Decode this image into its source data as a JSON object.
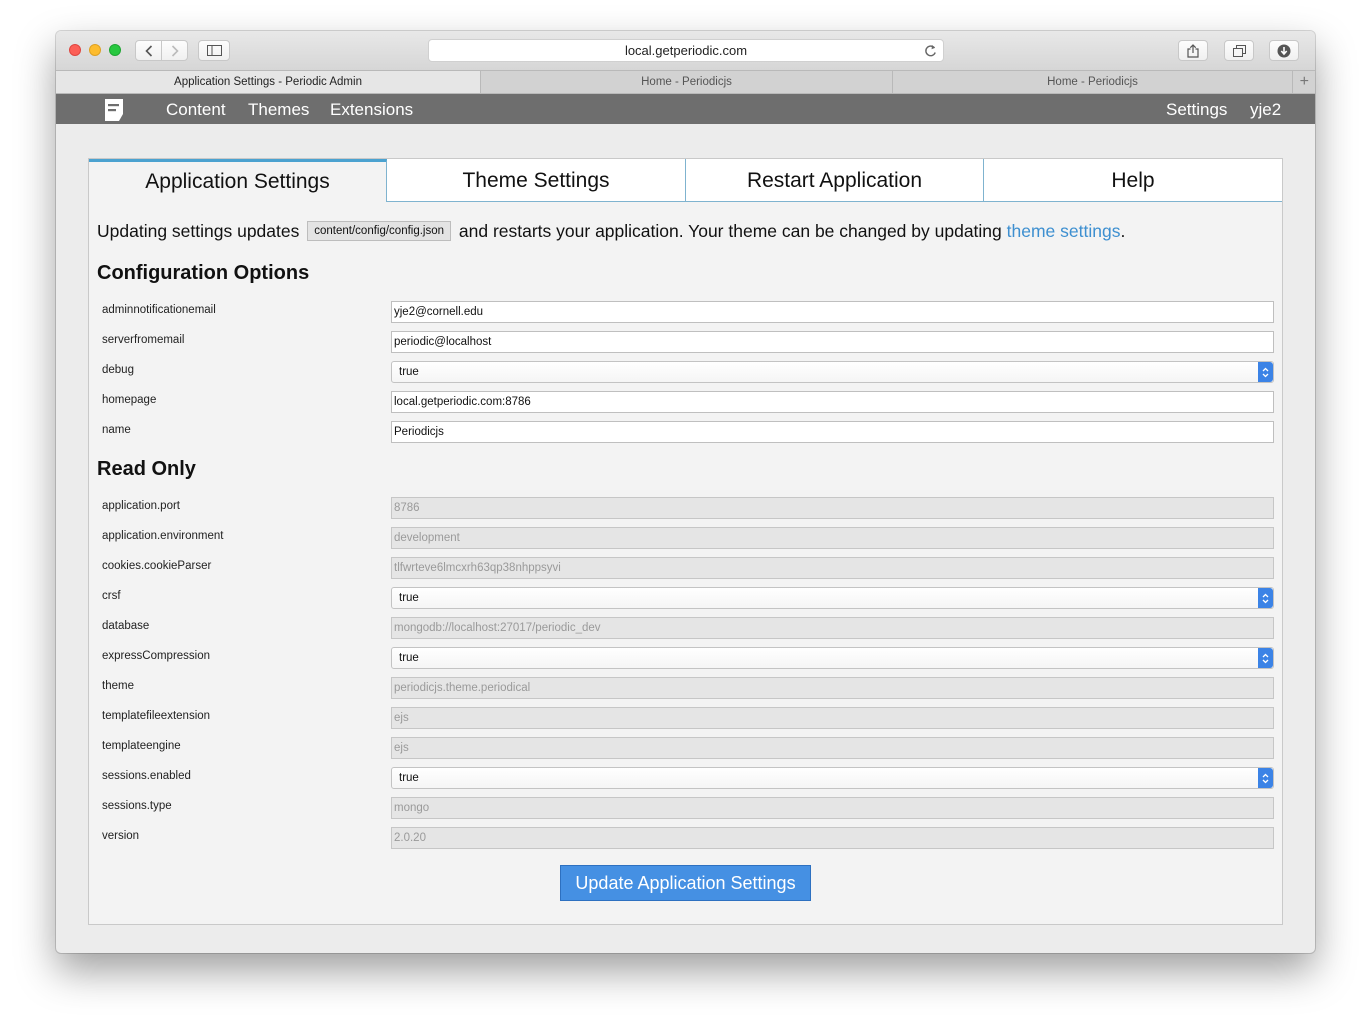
{
  "browser": {
    "url": "local.getperiodic.com",
    "tabs": [
      {
        "label": "Application Settings - Periodic Admin",
        "active": true
      },
      {
        "label": "Home - Periodicjs",
        "active": false
      },
      {
        "label": "Home - Periodicjs",
        "active": false
      }
    ],
    "new_tab": "+"
  },
  "nav": {
    "items": [
      "Content",
      "Themes",
      "Extensions"
    ],
    "settings": "Settings",
    "user": "yje2"
  },
  "tabs": [
    "Application Settings",
    "Theme Settings",
    "Restart Application",
    "Help"
  ],
  "intro": {
    "before": "Updating settings updates",
    "code": "content/config/config.json",
    "middle": " and restarts your application. Your theme can be changed by updating ",
    "link": "theme settings",
    "after": "."
  },
  "config": {
    "heading": "Configuration Options",
    "fields": [
      {
        "label": "adminnotificationemail",
        "value": "yje2@cornell.edu",
        "type": "text"
      },
      {
        "label": "serverfromemail",
        "value": "periodic@localhost",
        "type": "text"
      },
      {
        "label": "debug",
        "value": "true",
        "type": "select"
      },
      {
        "label": "homepage",
        "value": "local.getperiodic.com:8786",
        "type": "text"
      },
      {
        "label": "name",
        "value": "Periodicjs",
        "type": "text"
      }
    ]
  },
  "readonly": {
    "heading": "Read Only",
    "fields": [
      {
        "label": "application.port",
        "value": "8786",
        "type": "readonly"
      },
      {
        "label": "application.environment",
        "value": "development",
        "type": "readonly"
      },
      {
        "label": "cookies.cookieParser",
        "value": "tlfwrteve6lmcxrh63qp38nhppsyvi",
        "type": "readonly"
      },
      {
        "label": "crsf",
        "value": "true",
        "type": "select"
      },
      {
        "label": "database",
        "value": "mongodb://localhost:27017/periodic_dev",
        "type": "readonly"
      },
      {
        "label": "expressCompression",
        "value": "true",
        "type": "select"
      },
      {
        "label": "theme",
        "value": "periodicjs.theme.periodical",
        "type": "readonly"
      },
      {
        "label": "templatefileextension",
        "value": "ejs",
        "type": "readonly"
      },
      {
        "label": "templateengine",
        "value": "ejs",
        "type": "readonly"
      },
      {
        "label": "sessions.enabled",
        "value": "true",
        "type": "select"
      },
      {
        "label": "sessions.type",
        "value": "mongo",
        "type": "readonly"
      },
      {
        "label": "version",
        "value": "2.0.20",
        "type": "readonly"
      }
    ]
  },
  "submit_label": "Update Application Settings"
}
